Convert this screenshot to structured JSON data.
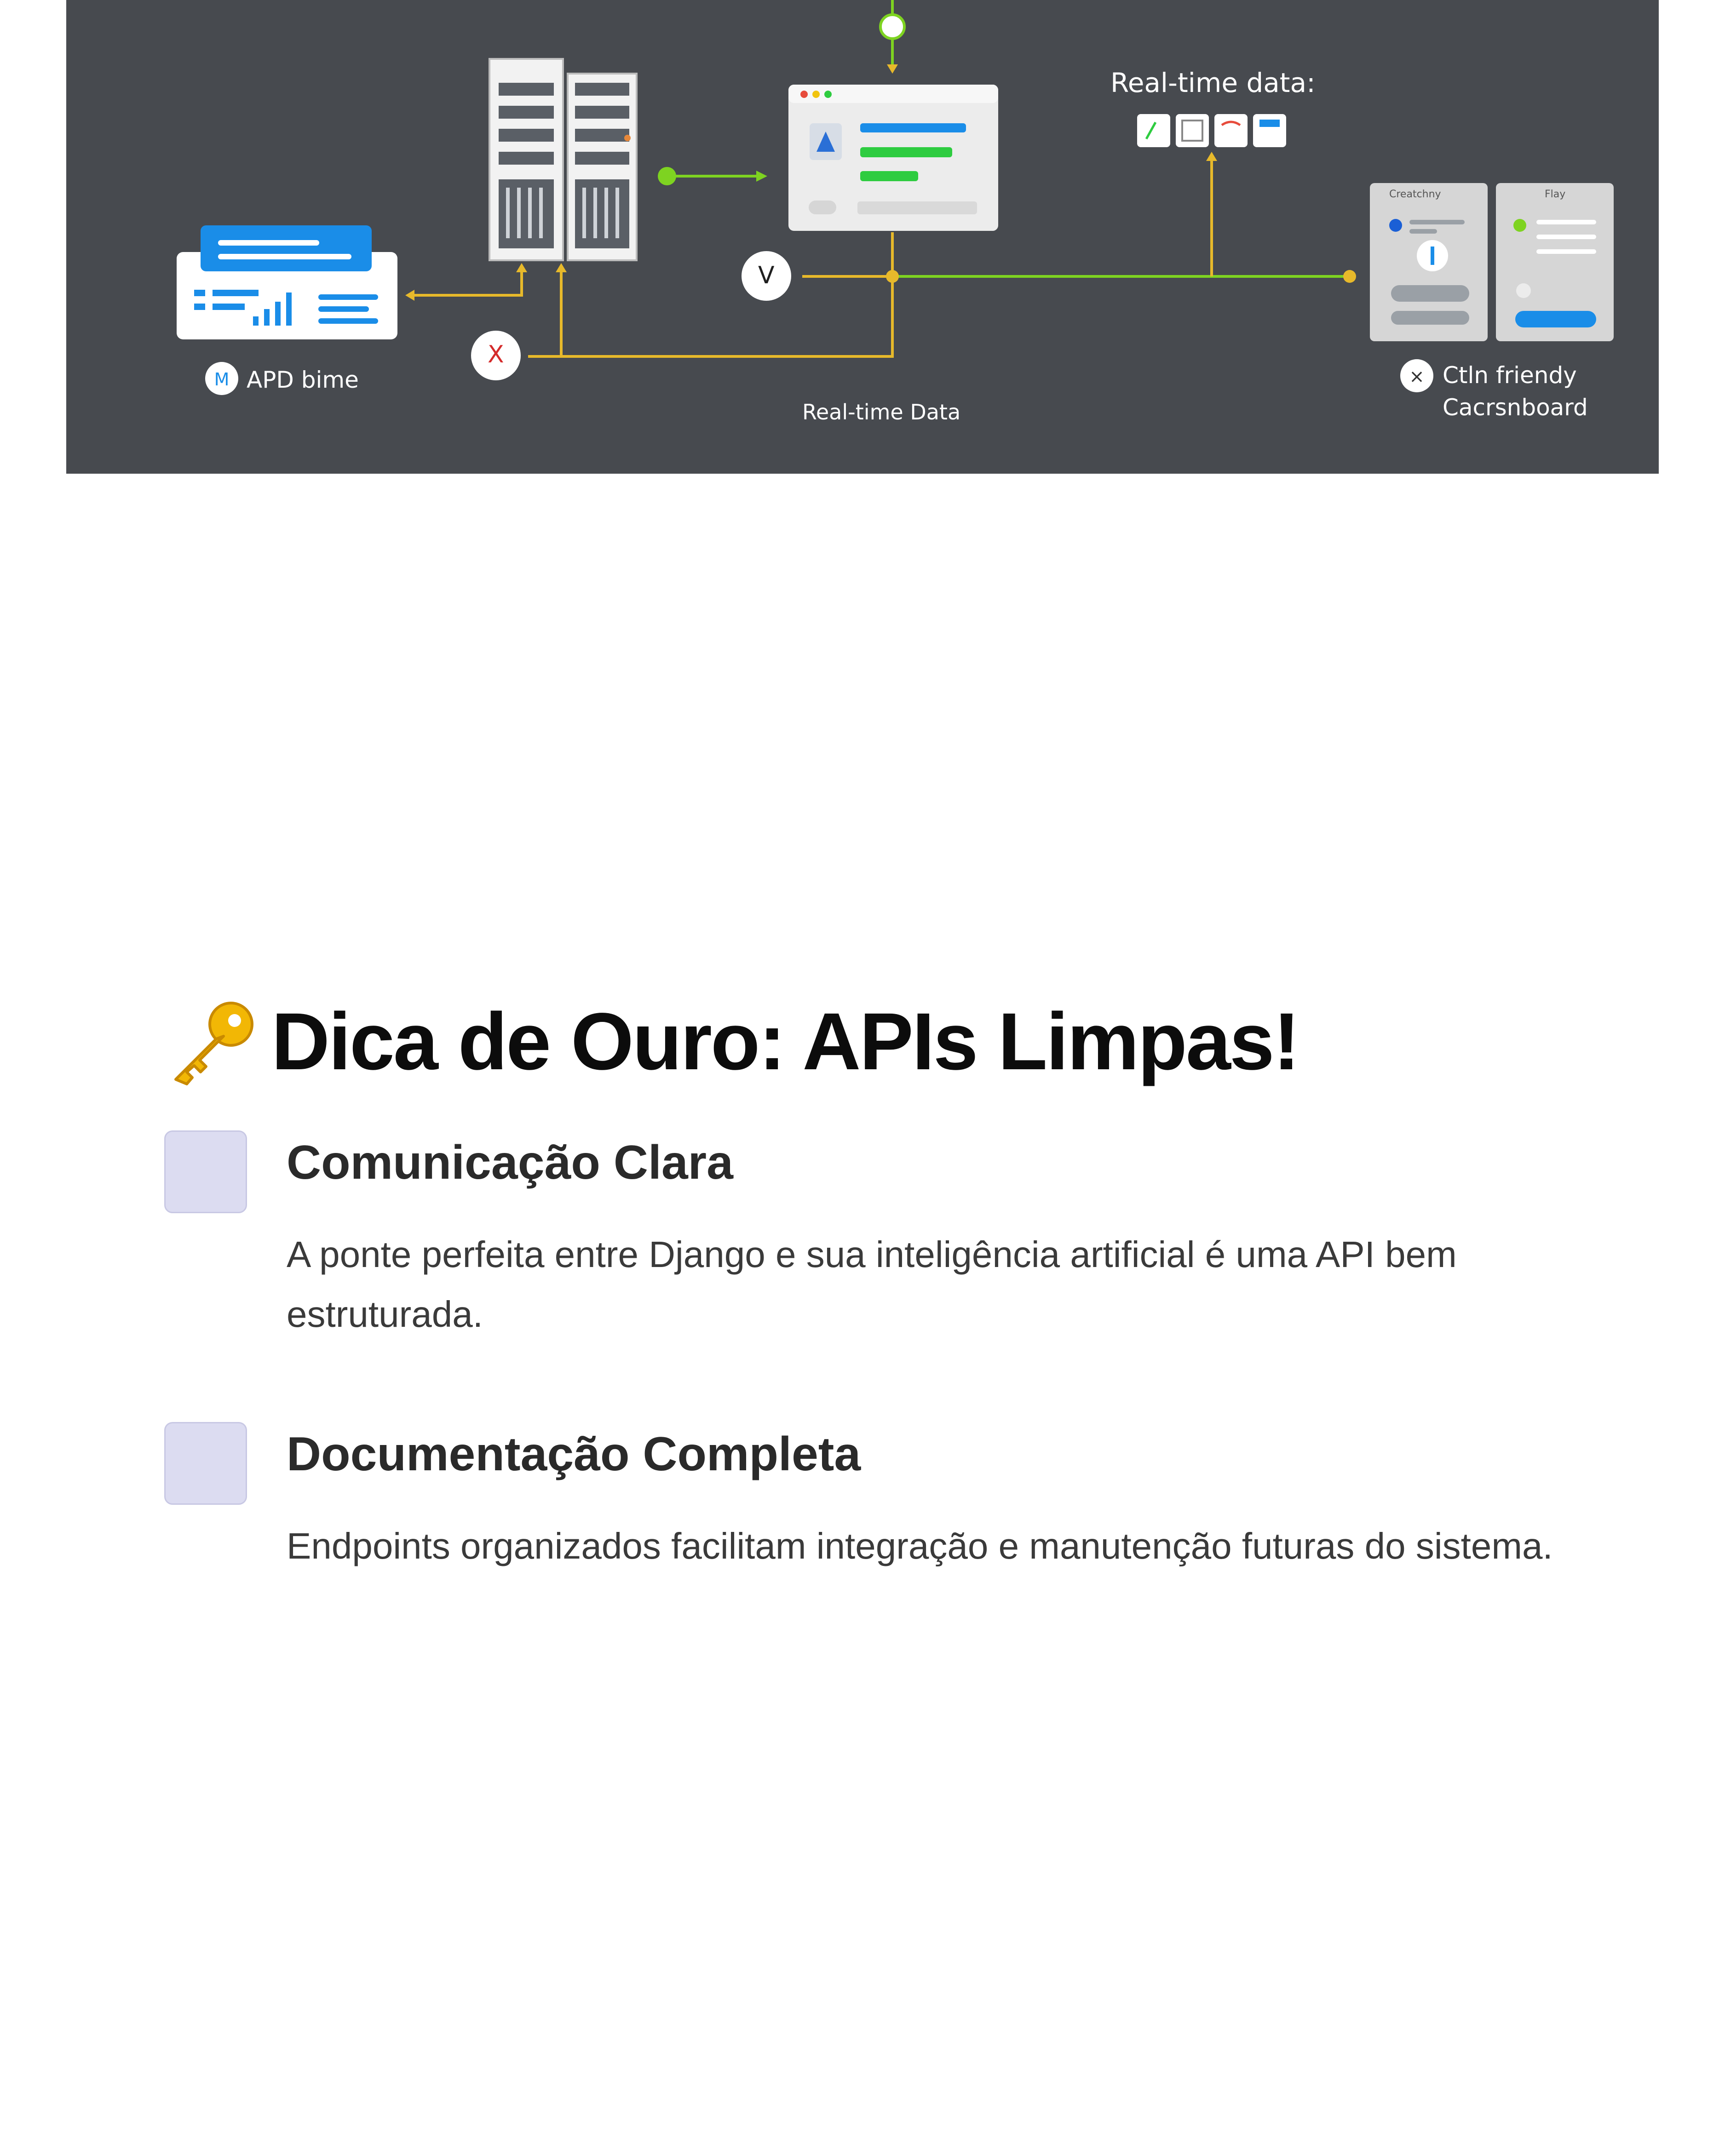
{
  "diagram": {
    "labels": {
      "realtime_top": "Real-time data:",
      "realtime_bottom": "Real-time Data",
      "left_caption": "APD bime",
      "right_caption_line1": "Ctln friendy",
      "right_caption_line2": "Cacrsnboard",
      "card_left_title": "Creatchny",
      "card_right_title": "Flay",
      "node_v": "V",
      "node_x": "X"
    },
    "colors": {
      "background": "#474a4f",
      "connector_yellow": "#e7b92b",
      "connector_green": "#7ed321",
      "accent_blue": "#1a8de8",
      "accent_green": "#2ecc40"
    }
  },
  "tip": {
    "icon": "key-icon",
    "title": "Dica de Ouro: APIs Limpas!",
    "items": [
      {
        "title": "Comunicação Clara",
        "text": "A ponte perfeita entre Django e sua inteligência artificial é uma API bem estruturada."
      },
      {
        "title": "Documentação Completa",
        "text": "Endpoints organizados facilitam integração e manutenção futuras do sistema."
      }
    ]
  }
}
